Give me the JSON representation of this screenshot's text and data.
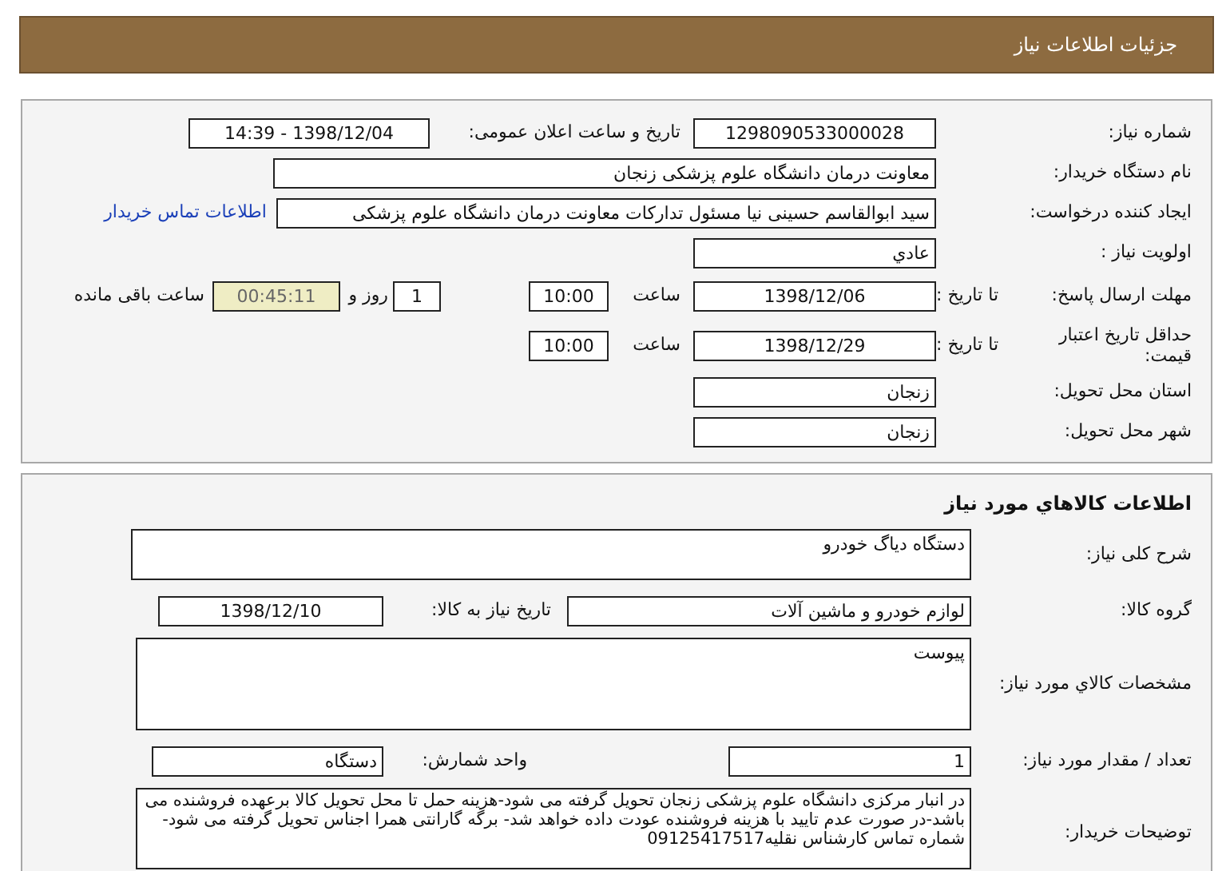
{
  "header": {
    "title": "جزئیات اطلاعات نیاز"
  },
  "request": {
    "need_number": {
      "label": "شماره نیاز:",
      "value": "1298090533000028"
    },
    "announce": {
      "label": "تاریخ و ساعت اعلان عمومی:",
      "value": "1398/12/04 - 14:39"
    },
    "buyer": {
      "label": "نام دستگاه خریدار:",
      "value": "معاونت درمان دانشگاه علوم پزشکی زنجان"
    },
    "creator": {
      "label": "ایجاد کننده درخواست:",
      "value": "سید ابوالقاسم  حسینی نیا مسئول تدارکات معاونت درمان دانشگاه علوم پزشکی",
      "link": "اطلاعات تماس خریدار"
    },
    "priority": {
      "label": "اولویت نیاز :",
      "value": "عادي"
    },
    "deadline": {
      "label": "مهلت ارسال پاسخ:",
      "date_label": "تا تاریخ :",
      "date": "1398/12/06",
      "time_label": "ساعت",
      "time": "10:00",
      "days": "1",
      "days_label": "روز و",
      "remaining": "00:45:11",
      "remaining_label": "ساعت باقی مانده"
    },
    "validity": {
      "label": "حداقل تاریخ اعتبار قیمت:",
      "date_label": "تا تاریخ :",
      "date": "1398/12/29",
      "time_label": "ساعت",
      "time": "10:00"
    },
    "province": {
      "label": "استان محل تحویل:",
      "value": "زنجان"
    },
    "city": {
      "label": "شهر محل تحویل:",
      "value": "زنجان"
    }
  },
  "goods": {
    "title": "اطلاعات كالاهاي مورد نياز",
    "description": {
      "label": "شرح کلی نیاز:",
      "value": "دستگاه دیاگ خودرو"
    },
    "group": {
      "label": "گروه کالا:",
      "value": "لوازم خودرو و ماشین آلات",
      "need_date_label": "تاریخ نیاز به کالا:",
      "need_date": "1398/12/10"
    },
    "specs": {
      "label": "مشخصات كالاي مورد نیاز:",
      "value": "پیوست"
    },
    "quantity": {
      "label": "تعداد / مقدار مورد نیاز:",
      "value": "1",
      "unit_label": "واحد شمارش:",
      "unit": "دستگاه"
    },
    "notes": {
      "label": "توضیحات خریدار:",
      "value": "در انبار مرکزی دانشگاه علوم پزشکی زنجان تحویل گرفته می شود-هزینه حمل تا محل تحویل کالا برعهده فروشنده می باشد-در صورت عدم تایید با هزینه فروشنده عودت داده خواهد شد- برگه گارانتی همرا اجناس تحویل گرفته می شود- شماره تماس کارشناس نقلیه09125417517"
    }
  }
}
